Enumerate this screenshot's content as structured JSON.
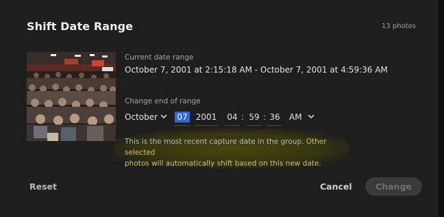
{
  "dialog": {
    "title": "Shift Date Range",
    "photo_count": "13 photos"
  },
  "current_range": {
    "label": "Current date range",
    "value": "October 7, 2001 at 2:15:18 AM - October 7, 2001 at 4:59:36 AM"
  },
  "change_end": {
    "label": "Change end of range",
    "month": "October",
    "day": "07",
    "year": "2001",
    "hour": "04",
    "minute": "59",
    "second": "36",
    "ampm": "AM",
    "colon": ":"
  },
  "info": {
    "text_plain": "This is the most recent capture date in the group.",
    "text_highlight_1": "Other selected",
    "text_highlight_2": "photos will automatically shift based on this new date."
  },
  "buttons": {
    "reset": "Reset",
    "cancel": "Cancel",
    "change": "Change"
  },
  "colors": {
    "background": "#1e1e1e",
    "selection": "#2f6bd3",
    "highlight_text": "#c7c26a"
  },
  "icons": {
    "thumbnail": "photo-thumbnail",
    "chevron": "chevron-down-icon"
  }
}
